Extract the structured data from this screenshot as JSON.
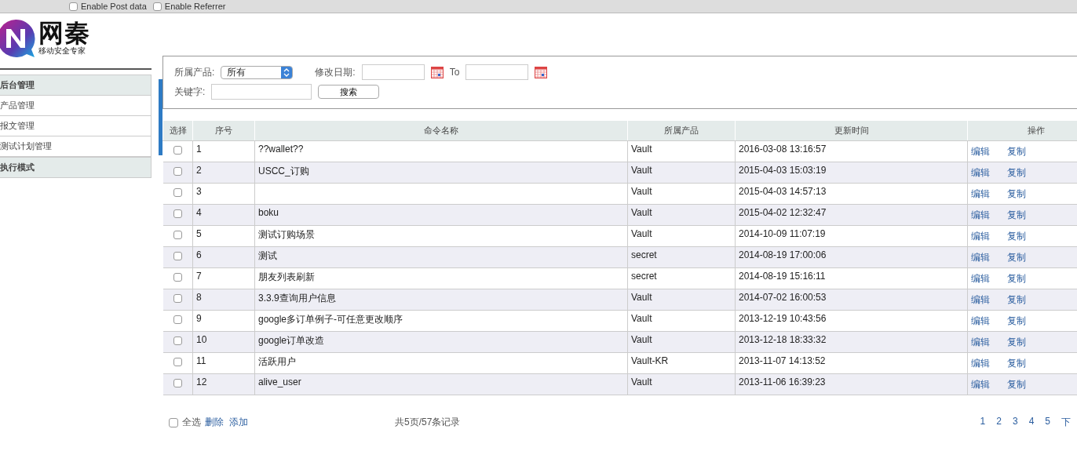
{
  "toolbar": {
    "options": [
      {
        "label": "Enable Post data",
        "checked": false
      },
      {
        "label": "Enable Referrer",
        "checked": false
      }
    ]
  },
  "logo": {
    "name": "网秦",
    "tagline": "移动安全专家"
  },
  "sidebar": {
    "items": [
      {
        "label": "后台管理",
        "kind": "header"
      },
      {
        "label": "产品管理",
        "kind": "link"
      },
      {
        "label": "报文管理",
        "kind": "link"
      },
      {
        "label": "测试计划管理",
        "kind": "link"
      },
      {
        "label": "执行模式",
        "kind": "header"
      }
    ]
  },
  "filter": {
    "product_label": "所属产品:",
    "product_value": "所有",
    "date_label": "修改日期:",
    "to_label": "To",
    "keyword_label": "关键字:",
    "search_button": "搜索"
  },
  "table": {
    "columns": [
      "选择",
      "序号",
      "命令名称",
      "所属产品",
      "更新时间",
      "操作"
    ],
    "rows": [
      {
        "checked": false,
        "no": "1",
        "name": "??wallet??",
        "product": "Vault",
        "updated": "2016-03-08 13:16:57",
        "actions": [
          "编辑",
          "复制"
        ]
      },
      {
        "checked": false,
        "no": "2",
        "name": "USCC_订购",
        "product": "Vault",
        "updated": "2015-04-03 15:03:19",
        "actions": [
          "编辑",
          "复制"
        ]
      },
      {
        "checked": false,
        "no": "3",
        "product": "Vault",
        "updated": "2015-04-03 14:57:13",
        "actions": [
          "编辑",
          "复制"
        ]
      },
      {
        "checked": false,
        "no": "4",
        "name": "boku",
        "product": "Vault",
        "updated": "2015-04-02 12:32:47",
        "actions": [
          "编辑",
          "复制"
        ]
      },
      {
        "checked": false,
        "no": "5",
        "name": "测试订购场景",
        "product": "Vault",
        "updated": "2014-10-09 11:07:19",
        "actions": [
          "编辑",
          "复制"
        ]
      },
      {
        "checked": false,
        "no": "6",
        "name": "测试",
        "product": "secret",
        "updated": "2014-08-19 17:00:06",
        "actions": [
          "编辑",
          "复制"
        ]
      },
      {
        "checked": false,
        "no": "7",
        "name": "朋友列表刷新",
        "product": "secret",
        "updated": "2014-08-19 15:16:11",
        "actions": [
          "编辑",
          "复制"
        ]
      },
      {
        "checked": false,
        "no": "8",
        "name": "3.3.9查询用户信息",
        "product": "Vault",
        "updated": "2014-07-02 16:00:53",
        "actions": [
          "编辑",
          "复制"
        ]
      },
      {
        "checked": false,
        "no": "9",
        "name": "google多订单例子-可任意更改顺序",
        "product": "Vault",
        "updated": "2013-12-19 10:43:56",
        "actions": [
          "编辑",
          "复制"
        ]
      },
      {
        "checked": false,
        "no": "10",
        "name": "google订单改造",
        "product": "Vault",
        "updated": "2013-12-18 18:33:32",
        "actions": [
          "编辑",
          "复制"
        ]
      },
      {
        "checked": false,
        "no": "11",
        "name": "活跃用户",
        "product": "Vault-KR",
        "updated": "2013-11-07 14:13:52",
        "actions": [
          "编辑",
          "复制"
        ]
      },
      {
        "checked": false,
        "no": "12",
        "name": "alive_user",
        "product": "Vault",
        "updated": "2013-11-06 16:39:23",
        "actions": [
          "编辑",
          "复制"
        ]
      }
    ]
  },
  "footer": {
    "select_all": {
      "label": "全选",
      "checked": false
    },
    "links": [
      "删除",
      "添加"
    ],
    "summary": "共5页/57条记录",
    "pages": [
      "1",
      "2",
      "3",
      "4",
      "5",
      "下"
    ]
  }
}
